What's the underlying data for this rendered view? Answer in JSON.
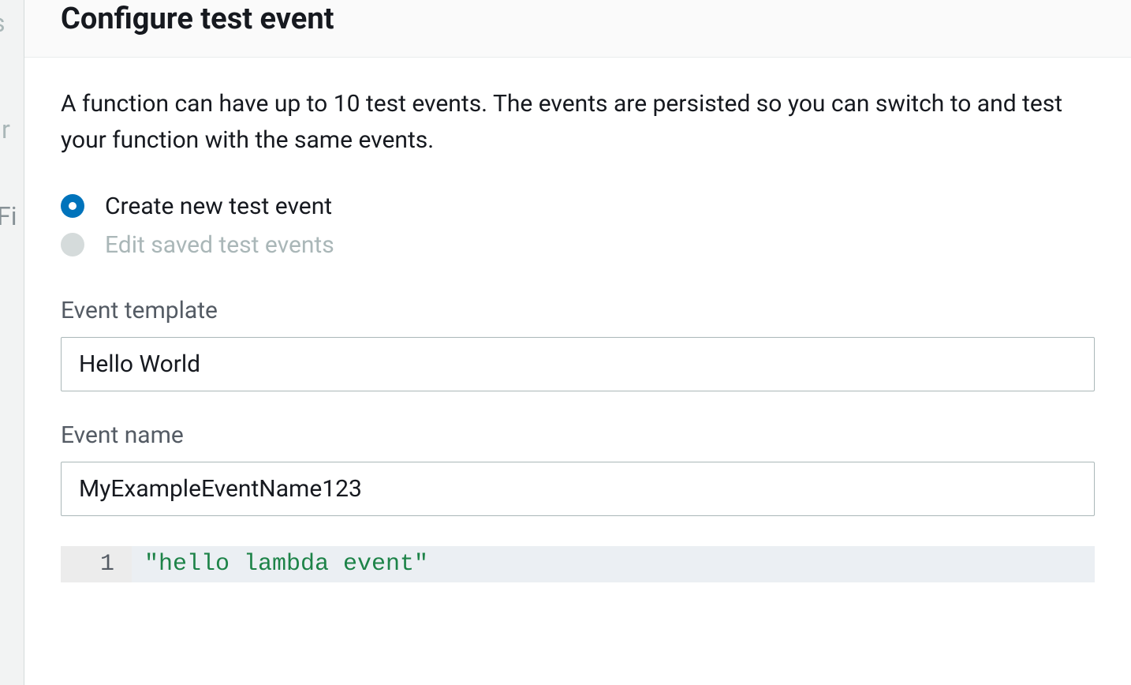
{
  "background": {
    "text1": "s",
    "text2": "r",
    "text3": "Fi"
  },
  "modal": {
    "title": "Configure test event",
    "description": "A function can have up to 10 test events. The events are persisted so you can switch to and test your function with the same events."
  },
  "radio": {
    "create_label": "Create new test event",
    "edit_label": "Edit saved test events"
  },
  "event_template": {
    "label": "Event template",
    "value": "Hello World"
  },
  "event_name": {
    "label": "Event name",
    "value": "MyExampleEventName123"
  },
  "code": {
    "line_number": "1",
    "content": "\"hello lambda event\""
  }
}
